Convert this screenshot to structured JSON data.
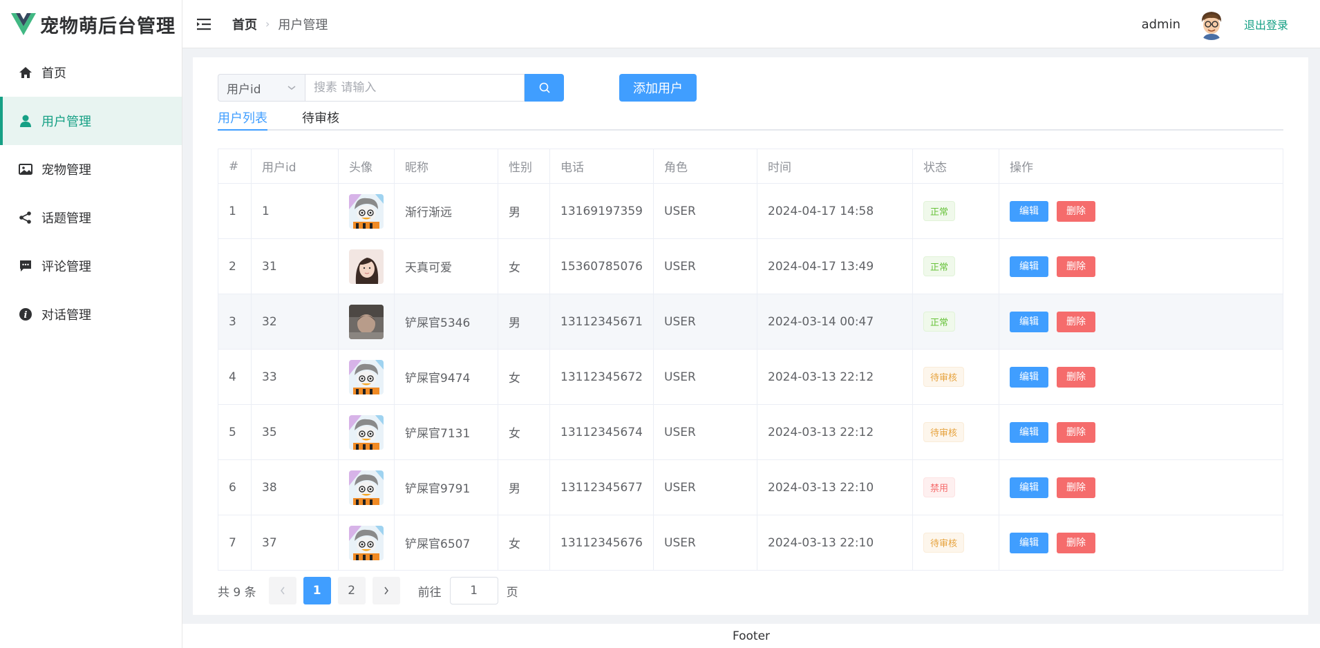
{
  "app": {
    "title": "宠物萌后台管理",
    "accent": "#16a085",
    "primary": "#409eff"
  },
  "sidebar": {
    "items": [
      {
        "label": "首页",
        "icon": "home-icon",
        "active": false
      },
      {
        "label": "用户管理",
        "icon": "user-icon",
        "active": true
      },
      {
        "label": "宠物管理",
        "icon": "picture-icon",
        "active": false
      },
      {
        "label": "话题管理",
        "icon": "share-icon",
        "active": false
      },
      {
        "label": "评论管理",
        "icon": "comment-icon",
        "active": false
      },
      {
        "label": "对话管理",
        "icon": "info-icon",
        "active": false
      }
    ]
  },
  "header": {
    "breadcrumb_home": "首页",
    "breadcrumb_current": "用户管理",
    "username": "admin",
    "logout": "退出登录"
  },
  "search": {
    "select_value": "用户id",
    "placeholder": "搜素 请输入",
    "add_button": "添加用户"
  },
  "tabs": [
    {
      "label": "用户列表",
      "active": true
    },
    {
      "label": "待审核",
      "active": false
    }
  ],
  "table": {
    "headers": [
      "#",
      "用户id",
      "头像",
      "昵称",
      "性别",
      "电话",
      "角色",
      "时间",
      "状态",
      "操作"
    ],
    "rows": [
      {
        "index": "1",
        "id": "1",
        "avatar": "cartoon",
        "nickname": "渐行渐远",
        "gender": "男",
        "phone": "13169197359",
        "role": "USER",
        "time": "2024-04-17 14:58",
        "status": "正常",
        "status_type": "ok"
      },
      {
        "index": "2",
        "id": "31",
        "avatar": "photo-girl",
        "nickname": "天真可爱",
        "gender": "女",
        "phone": "15360785076",
        "role": "USER",
        "time": "2024-04-17 13:49",
        "status": "正常",
        "status_type": "ok"
      },
      {
        "index": "3",
        "id": "32",
        "avatar": "photo-dark",
        "nickname": "铲屎官5346",
        "gender": "男",
        "phone": "13112345671",
        "role": "USER",
        "time": "2024-03-14 00:47",
        "status": "正常",
        "status_type": "ok"
      },
      {
        "index": "4",
        "id": "33",
        "avatar": "cartoon",
        "nickname": "铲屎官9474",
        "gender": "女",
        "phone": "13112345672",
        "role": "USER",
        "time": "2024-03-13 22:12",
        "status": "待审核",
        "status_type": "pending"
      },
      {
        "index": "5",
        "id": "35",
        "avatar": "cartoon",
        "nickname": "铲屎官7131",
        "gender": "女",
        "phone": "13112345674",
        "role": "USER",
        "time": "2024-03-13 22:12",
        "status": "待审核",
        "status_type": "pending"
      },
      {
        "index": "6",
        "id": "38",
        "avatar": "cartoon",
        "nickname": "铲屎官9791",
        "gender": "男",
        "phone": "13112345677",
        "role": "USER",
        "time": "2024-03-13 22:10",
        "status": "禁用",
        "status_type": "disabled"
      },
      {
        "index": "7",
        "id": "37",
        "avatar": "cartoon",
        "nickname": "铲屎官6507",
        "gender": "女",
        "phone": "13112345676",
        "role": "USER",
        "time": "2024-03-13 22:10",
        "status": "待审核",
        "status_type": "pending"
      }
    ],
    "edit_label": "编辑",
    "delete_label": "删除"
  },
  "pagination": {
    "total_text": "共 9 条",
    "pages": [
      "1",
      "2"
    ],
    "current": "1",
    "goto_label": "前往",
    "goto_value": "1",
    "unit": "页"
  },
  "footer": {
    "text": "Footer"
  }
}
